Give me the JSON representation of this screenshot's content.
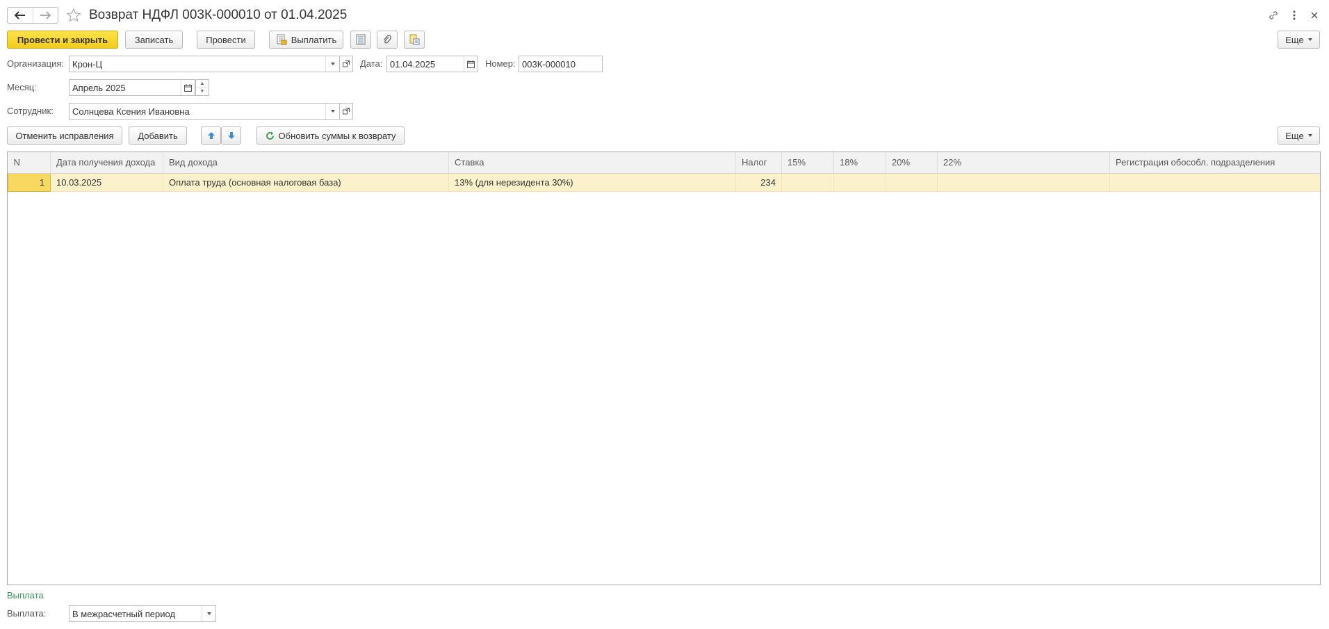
{
  "title": "Возврат НДФЛ 003К-000010 от 01.04.2025",
  "toolbar": {
    "post_close": "Провести и закрыть",
    "save": "Записать",
    "post": "Провести",
    "pay": "Выплатить",
    "more": "Еще"
  },
  "form": {
    "org_label": "Организация:",
    "org_value": "Крон-Ц",
    "date_label": "Дата:",
    "date_value": "01.04.2025",
    "number_label": "Номер:",
    "number_value": "003К-000010",
    "month_label": "Месяц:",
    "month_value": "Апрель 2025",
    "employee_label": "Сотрудник:",
    "employee_value": "Солнцева Ксения Ивановна"
  },
  "table_toolbar": {
    "cancel_fixes": "Отменить исправления",
    "add": "Добавить",
    "refresh": "Обновить суммы к возврату",
    "more": "Еще"
  },
  "table": {
    "columns": [
      "N",
      "Дата получения дохода",
      "Вид дохода",
      "Ставка",
      "Налог",
      "15%",
      "18%",
      "20%",
      "22%",
      "Регистрация обособл. подразделения"
    ],
    "rows": [
      [
        "1",
        "10.03.2025",
        "Оплата труда (основная налоговая база)",
        "13% (для нерезидента 30%)",
        "234",
        "",
        "",
        "",
        "",
        ""
      ]
    ]
  },
  "payment": {
    "section_title": "Выплата",
    "label": "Выплата:",
    "value": "В межрасчетный период"
  },
  "colors": {
    "primary_button": "#f4cc1b",
    "selected_row": "#fbf2cc",
    "section_title": "#3a9a5b"
  }
}
